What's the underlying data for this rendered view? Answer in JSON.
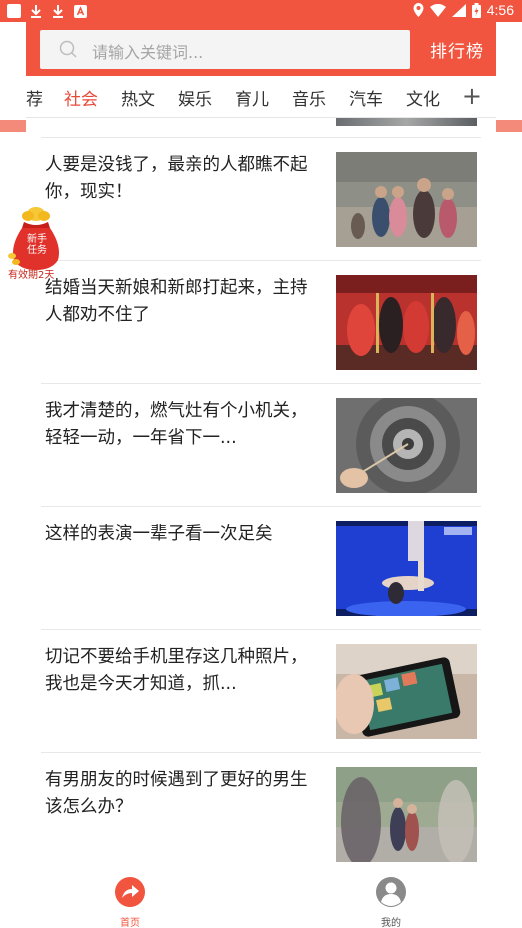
{
  "status_bar": {
    "time": "4:56"
  },
  "search": {
    "placeholder": "请输入关键词..."
  },
  "header": {
    "rank_label": "排行榜"
  },
  "tabs": [
    {
      "label": "荐"
    },
    {
      "label": "社会",
      "active": true
    },
    {
      "label": "热文"
    },
    {
      "label": "娱乐"
    },
    {
      "label": "育儿"
    },
    {
      "label": "音乐"
    },
    {
      "label": "汽车"
    },
    {
      "label": "文化"
    }
  ],
  "tabs_add_icon": "plus-icon",
  "articles": [
    {
      "title": "人要是没钱了，最亲的人都瞧不起你，现实！",
      "thumb": "family-gathering"
    },
    {
      "title": "结婚当天新娘和新郎打起来，主持人都劝不住了",
      "thumb": "wedding-stage"
    },
    {
      "title": "我才清楚的，燃气灶有个小机关，轻轻一动，一年省下一...",
      "thumb": "gas-stove-burner"
    },
    {
      "title": "这样的表演一辈子看一次足矣",
      "thumb": "stage-performance"
    },
    {
      "title": "切记不要给手机里存这几种照片，我也是今天才知道，抓...",
      "thumb": "phone-photos"
    },
    {
      "title": "有男朋友的时候遇到了更好的男生该怎么办？",
      "thumb": "street-people"
    }
  ],
  "badge": {
    "line1": "新手",
    "line2": "任务",
    "caption": "有效期2天"
  },
  "bottom_nav": [
    {
      "label": "首页",
      "icon": "share-arrow-icon",
      "active": true
    },
    {
      "label": "我的",
      "icon": "user-icon",
      "active": false
    }
  ],
  "colors": {
    "brand": "#f2553f",
    "active_tab": "#e84a3a"
  }
}
